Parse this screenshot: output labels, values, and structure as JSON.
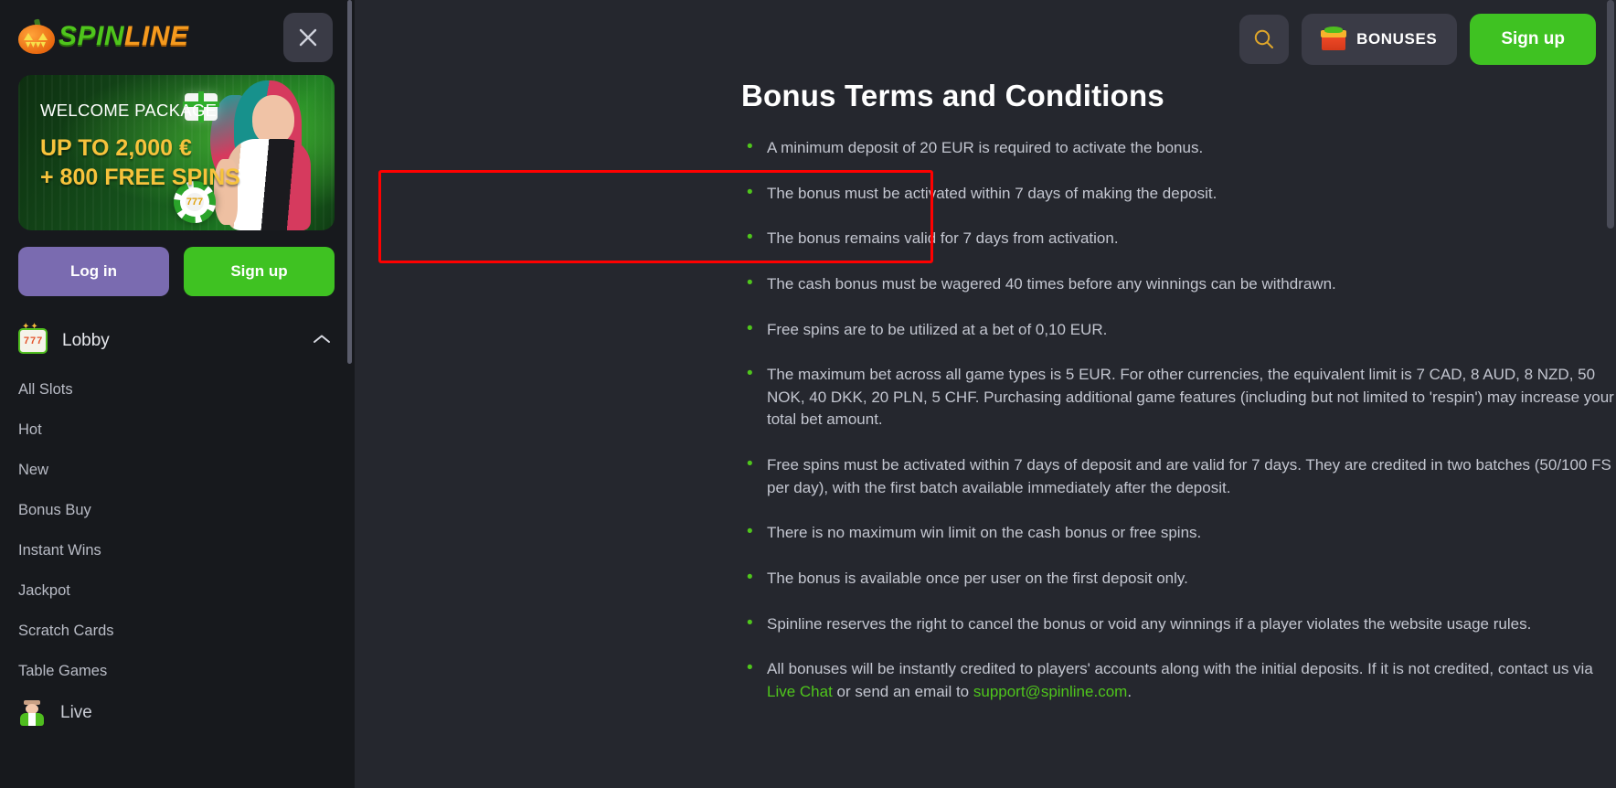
{
  "brand": {
    "name_part1": "SPIN",
    "name_part2": "LINE",
    "pumpkin_icon": "pumpkin-icon",
    "bat_icon": "bat-icon"
  },
  "sidebar": {
    "close_label": "×",
    "promo": {
      "title": "WELCOME PACKAGE",
      "line1": "UP TO 2,000 €",
      "line2": "+ 800 FREE SPINS",
      "chip_label": "777"
    },
    "login_label": "Log in",
    "signup_label": "Sign up",
    "lobby": {
      "label": "Lobby",
      "icon": "slot-machine-icon",
      "reel_symbols": [
        "7",
        "7",
        "7"
      ],
      "chevron": "chevron-up-icon",
      "expanded": true
    },
    "items": [
      {
        "label": "All Slots"
      },
      {
        "label": "Hot"
      },
      {
        "label": "New"
      },
      {
        "label": "Bonus Buy"
      },
      {
        "label": "Instant Wins"
      },
      {
        "label": "Jackpot"
      },
      {
        "label": "Scratch Cards"
      },
      {
        "label": "Table Games"
      }
    ],
    "live": {
      "label": "Live",
      "icon": "live-dealer-icon"
    }
  },
  "header": {
    "search_icon": "search-icon",
    "bonuses_label": "BONUSES",
    "bonuses_icon": "gift-icon",
    "signup_label": "Sign up"
  },
  "main": {
    "title": "Bonus Terms and Conditions",
    "terms": [
      {
        "text": "A minimum deposit of 20 EUR is required to activate the bonus."
      },
      {
        "text": "The bonus must be activated within 7 days of making the deposit."
      },
      {
        "text": "The bonus remains valid for 7 days from activation."
      },
      {
        "text": "The cash bonus must be wagered 40 times before any winnings can be withdrawn."
      },
      {
        "text": "Free spins are to be utilized at a bet of 0,10 EUR."
      },
      {
        "text": "The maximum bet across all game types is 5 EUR. For other currencies, the equivalent limit is 7 CAD, 8 AUD, 8 NZD, 50 NOK, 40 DKK, 20 PLN, 5 CHF. Purchasing additional game features (including but not limited to 'respin') may increase your total bet amount."
      },
      {
        "text": "Free spins must be activated within 7 days of deposit and are valid for 7 days. They are credited in two batches (50/100 FS per day), with the first batch available immediately after the deposit."
      },
      {
        "text": "There is no maximum win limit on the cash bonus or free spins."
      },
      {
        "text": "The bonus is available once per user on the first deposit only."
      },
      {
        "text": "Spinline reserves the right to cancel the bonus or void any winnings if a player violates the website usage rules."
      }
    ],
    "support_term": {
      "prefix": "All bonuses will be instantly credited to players' accounts along with the initial deposits. If it is not credited, contact us via ",
      "live_chat": "Live Chat",
      "middle": " or send an email to ",
      "email": "support@spinline.com",
      "suffix": "."
    }
  },
  "colors": {
    "accent_green": "#4fc51c",
    "brand_orange": "#f59a1e",
    "highlight_red": "#ff0000",
    "purple_button": "#7a6bb0",
    "sidebar_bg": "#17191d",
    "main_bg": "#25272e"
  }
}
